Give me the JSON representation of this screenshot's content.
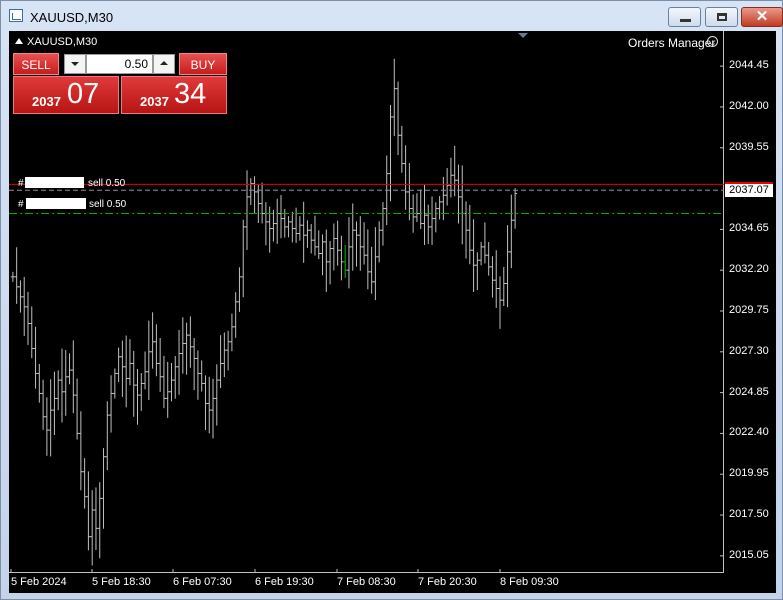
{
  "window": {
    "title": "XAUUSD,M30",
    "buttons": {
      "minimize": "minimize",
      "maximize": "maximize",
      "close": "✕"
    }
  },
  "chart": {
    "symbol_label": "XAUUSD,M30",
    "orders_manager": "Orders Manager",
    "current_price": "2037.07",
    "price_axis": [
      "2044.45",
      "2042.00",
      "2039.55",
      "2037.07",
      "2034.65",
      "2032.20",
      "2029.75",
      "2027.30",
      "2024.85",
      "2022.40",
      "2019.95",
      "2017.50",
      "2015.05"
    ],
    "time_axis": [
      "5 Feb 2024",
      "5 Feb 18:30",
      "6 Feb 07:30",
      "6 Feb 19:30",
      "7 Feb 08:30",
      "7 Feb 20:30",
      "8 Feb 09:30"
    ],
    "colors": {
      "background": "#000000",
      "bars": "#c0c0c0",
      "sell_line": "#ff2020",
      "sl_line": "#00c000"
    }
  },
  "trade_panel": {
    "sell_label": "SELL",
    "buy_label": "BUY",
    "lot_value": "0.50",
    "bid_prefix": "2037",
    "bid_big": "07",
    "ask_prefix": "2037",
    "ask_big": "34"
  },
  "orders": [
    {
      "hash": "#",
      "label": "sell 0.50"
    },
    {
      "hash": "#",
      "label": "sell 0.50"
    }
  ],
  "chart_data": {
    "type": "ohlc",
    "title": "XAUUSD,M30",
    "ylim": [
      2014.2,
      2046.5
    ],
    "y_ticks": [
      2044.45,
      2042.0,
      2039.55,
      2037.07,
      2034.65,
      2032.2,
      2029.75,
      2027.3,
      2024.85,
      2022.4,
      2019.95,
      2017.5,
      2015.05
    ],
    "x_tick_labels": [
      "5 Feb 2024",
      "5 Feb 18:30",
      "6 Feb 07:30",
      "6 Feb 19:30",
      "7 Feb 08:30",
      "7 Feb 20:30",
      "8 Feb 09:30"
    ],
    "close_series": [
      2031.8,
      2031.2,
      2030.6,
      2030.0,
      2029.0,
      2027.5,
      2026.0,
      2024.8,
      2023.4,
      2022.6,
      2023.8,
      2024.5,
      2025.6,
      2024.9,
      2025.8,
      2026.2,
      2024.7,
      2022.4,
      2020.1,
      2018.6,
      2016.2,
      2017.8,
      2016.7,
      2018.5,
      2021.0,
      2023.5,
      2024.8,
      2026.0,
      2027.0,
      2026.4,
      2025.7,
      2026.6,
      2025.3,
      2024.7,
      2025.4,
      2026.1,
      2027.3,
      2027.9,
      2026.6,
      2025.8,
      2024.5,
      2024.9,
      2025.6,
      2026.4,
      2027.2,
      2027.8,
      2028.3,
      2027.6,
      2026.9,
      2026.0,
      2025.4,
      2024.2,
      2023.8,
      2024.5,
      2025.6,
      2026.6,
      2027.4,
      2027.9,
      2028.8,
      2030.3,
      2031.8,
      2034.8,
      2036.6,
      2037.4,
      2036.9,
      2036.2,
      2035.6,
      2035.1,
      2034.7,
      2035.0,
      2035.6,
      2035.3,
      2034.8,
      2035.1,
      2034.7,
      2034.4,
      2034.9,
      2034.3,
      2034.6,
      2034.0,
      2033.6,
      2033.2,
      2033.9,
      2032.7,
      2033.5,
      2034.1,
      2033.4,
      2032.7,
      2032.2,
      2033.6,
      2034.6,
      2034.3,
      2033.6,
      2033.1,
      2032.1,
      2031.5,
      2033.0,
      2034.6,
      2035.9,
      2038.0,
      2041.4,
      2043.1,
      2040.3,
      2038.6,
      2036.9,
      2035.9,
      2035.4,
      2035.6,
      2035.0,
      2035.5,
      2034.8,
      2035.3,
      2035.9,
      2036.3,
      2036.7,
      2037.3,
      2037.9,
      2037.6,
      2036.6,
      2035.6,
      2034.6,
      2033.4,
      2032.5,
      2032.8,
      2033.6,
      2033.1,
      2032.4,
      2031.6,
      2031.1,
      2030.4,
      2031.4,
      2033.3,
      2035.2,
      2036.8
    ]
  }
}
